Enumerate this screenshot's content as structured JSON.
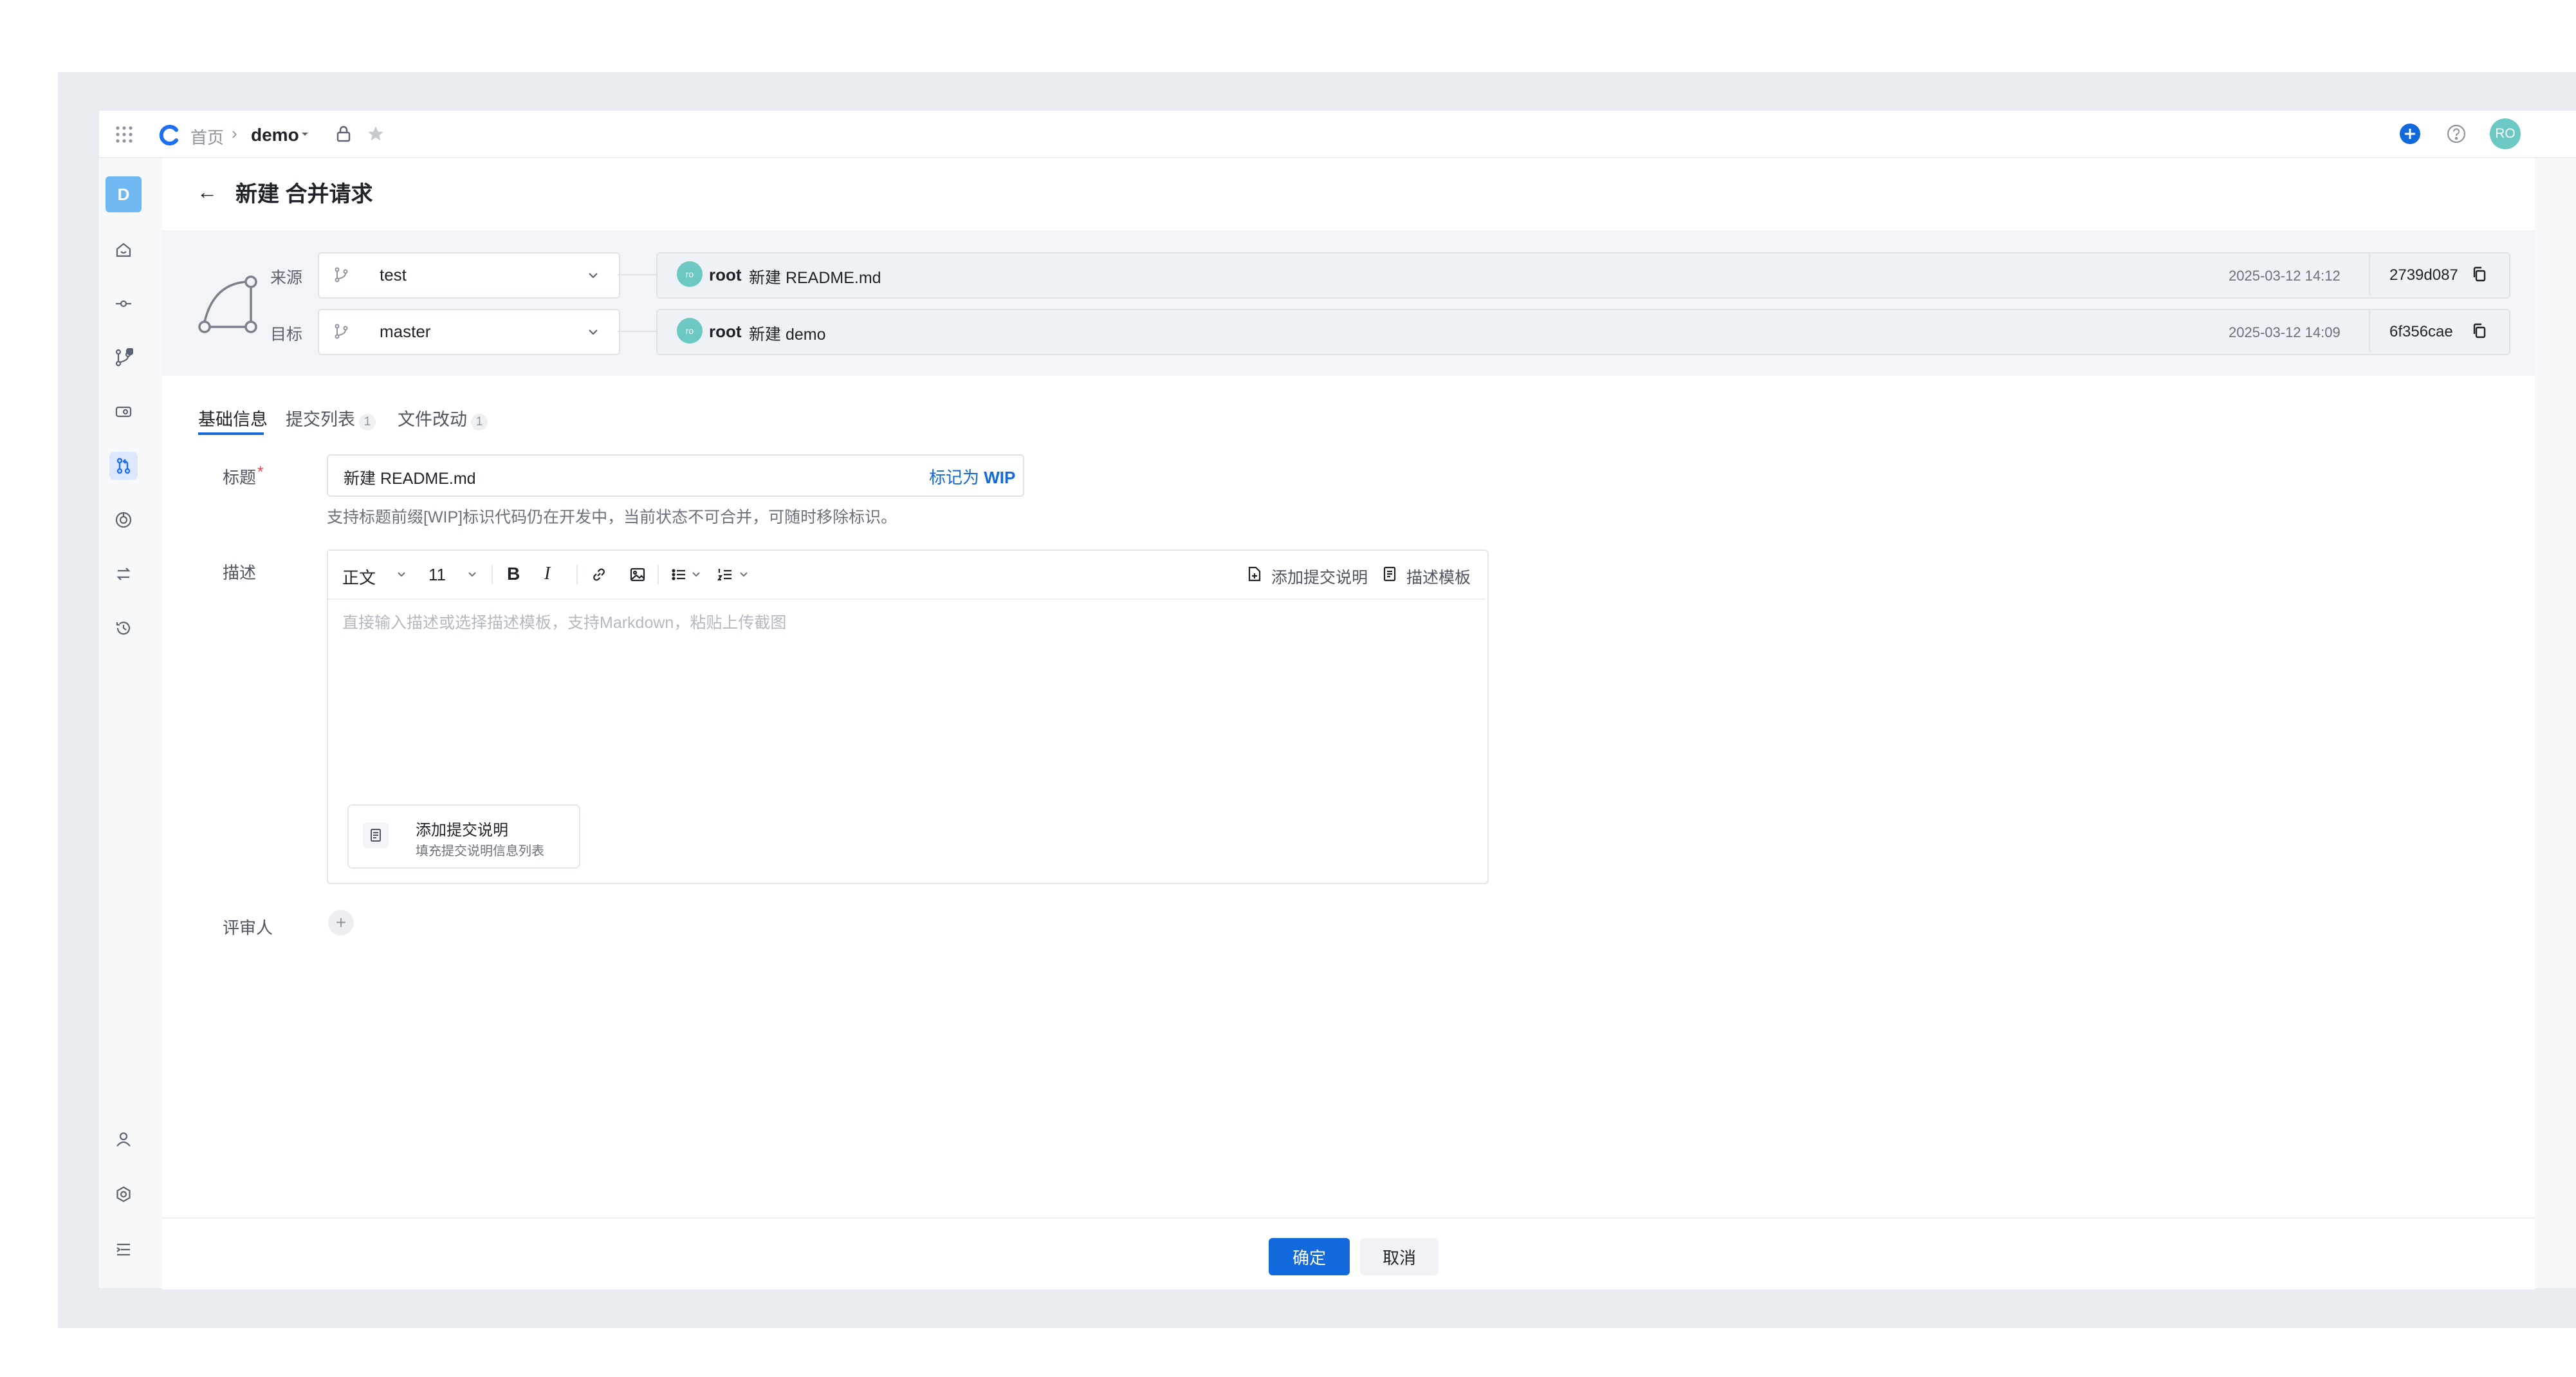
{
  "colors": {
    "accent": "#1269db",
    "avatar": "#6bc8c2",
    "frame": "#e9ecf0"
  },
  "topbar": {
    "breadcrumb_home": "首页",
    "breadcrumb_sep": "›",
    "project": "demo",
    "user_avatar": "RO"
  },
  "sidebar": {
    "project_badge": "D",
    "items": [
      {
        "icon": "home-icon"
      },
      {
        "icon": "commit-icon"
      },
      {
        "icon": "branch-icon"
      },
      {
        "icon": "tag-icon"
      },
      {
        "icon": "merge-request-icon",
        "active": true
      },
      {
        "icon": "pipeline-icon"
      },
      {
        "icon": "compare-icon"
      },
      {
        "icon": "history-icon"
      }
    ],
    "bottom_items": [
      {
        "icon": "member-icon"
      },
      {
        "icon": "settings-icon"
      },
      {
        "icon": "collapse-icon"
      }
    ]
  },
  "page": {
    "back_icon": "←",
    "title": "新建 合并请求"
  },
  "branches": {
    "source": {
      "label": "来源",
      "branch": "test",
      "author_avatar": "ro",
      "author": "root",
      "message": "新建 README.md",
      "time": "2025-03-12 14:12",
      "sha": "2739d087"
    },
    "target": {
      "label": "目标",
      "branch": "master",
      "author_avatar": "ro",
      "author": "root",
      "message": "新建 demo",
      "time": "2025-03-12 14:09",
      "sha": "6f356cae"
    }
  },
  "tabs": [
    {
      "label": "基础信息",
      "active": true
    },
    {
      "label": "提交列表",
      "count": "1"
    },
    {
      "label": "文件改动",
      "count": "1"
    }
  ],
  "form": {
    "title_label": "标题",
    "required_mark": "*",
    "title_value": "新建 README.md",
    "wip_prefix": "标记为",
    "wip_text": "WIP",
    "title_hint": "支持标题前缀[WIP]标识代码仍在开发中，当前状态不可合并，可随时移除标识。",
    "desc_label": "描述",
    "toolbar": {
      "style": "正文",
      "size": "11",
      "bold": "B",
      "italic": "I",
      "add_commit_desc": "添加提交说明",
      "desc_template": "描述模板"
    },
    "desc_placeholder": "直接输入描述或选择描述模板，支持Markdown，粘贴上传截图",
    "card_title": "添加提交说明",
    "card_subtitle": "填充提交说明信息列表",
    "reviewer_label": "评审人",
    "reviewer_add": "+"
  },
  "footer": {
    "confirm": "确定",
    "cancel": "取消"
  }
}
